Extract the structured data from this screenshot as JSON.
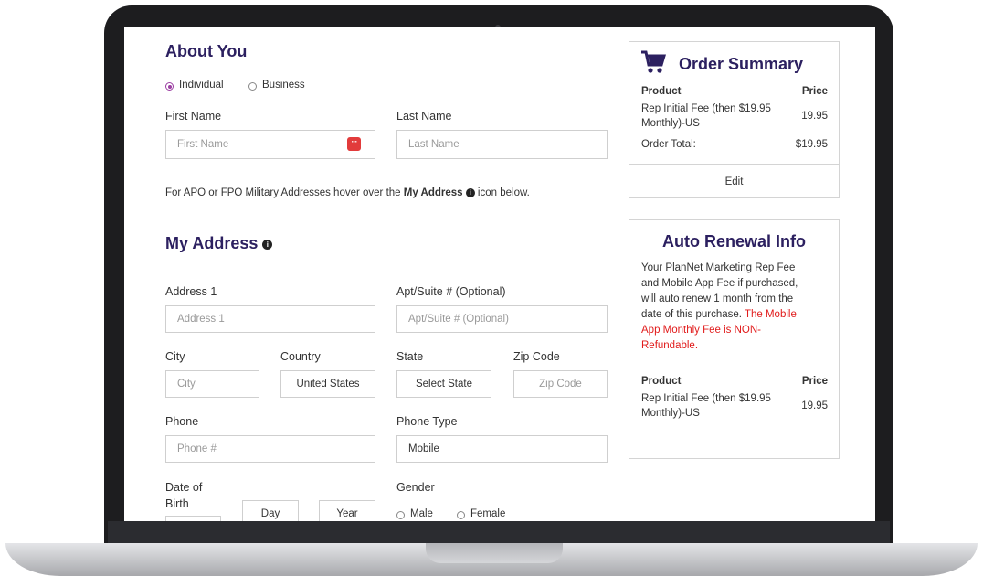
{
  "about": {
    "title": "About You",
    "account_type": {
      "options": [
        "Individual",
        "Business"
      ],
      "selected": "Individual"
    },
    "first_name": {
      "label": "First Name",
      "placeholder": "First Name"
    },
    "last_name": {
      "label": "Last Name",
      "placeholder": "Last Name"
    },
    "military_note": {
      "prefix": "For APO or FPO Military Addresses hover over the ",
      "link": "My Address",
      "suffix": " icon below."
    }
  },
  "address": {
    "title": "My Address",
    "address1": {
      "label": "Address 1",
      "placeholder": "Address 1"
    },
    "apt": {
      "label": "Apt/Suite # (Optional)",
      "placeholder": "Apt/Suite # (Optional)"
    },
    "city": {
      "label": "City",
      "placeholder": "City"
    },
    "country": {
      "label": "Country",
      "value": "United States"
    },
    "state": {
      "label": "State",
      "value": "Select State"
    },
    "zip": {
      "label": "Zip Code",
      "placeholder": "Zip Code"
    },
    "phone": {
      "label": "Phone",
      "placeholder": "Phone #"
    },
    "phone_type": {
      "label": "Phone Type",
      "value": "Mobile"
    },
    "dob": {
      "label_line1": "Date of",
      "label_line2": "Birth",
      "day": "Day",
      "year": "Year"
    },
    "gender": {
      "label": "Gender",
      "options": [
        "Male",
        "Female"
      ]
    }
  },
  "order_summary": {
    "title": "Order Summary",
    "header_product": "Product",
    "header_price": "Price",
    "item_line1": "Rep Initial Fee (then $19.95",
    "item_line2": "Monthly)-US",
    "item_price": "19.95",
    "total_label": "Order Total:",
    "total_value": "$19.95",
    "edit_label": "Edit"
  },
  "auto_renewal": {
    "title": "Auto Renewal Info",
    "body_lines": [
      "Your PlanNet Marketing Rep Fee",
      "and Mobile App Fee if purchased,",
      "will auto renew 1 month from the",
      "date of this purchase. "
    ],
    "warning_lines": [
      "The Mobile",
      "App Monthly Fee is NON-",
      "Refundable."
    ],
    "header_product": "Product",
    "header_price": "Price",
    "item_line1": "Rep Initial Fee (then $19.95",
    "item_line2": "Monthly)-US",
    "item_price": "19.95"
  },
  "icons": {
    "info": "info-icon",
    "cart": "cart-icon",
    "password_manager": "password-manager-icon"
  },
  "colors": {
    "heading": "#2c2060",
    "radio_accent": "#9b3fa2",
    "warning": "#e11b1b",
    "pm_icon": "#e23b3b"
  }
}
